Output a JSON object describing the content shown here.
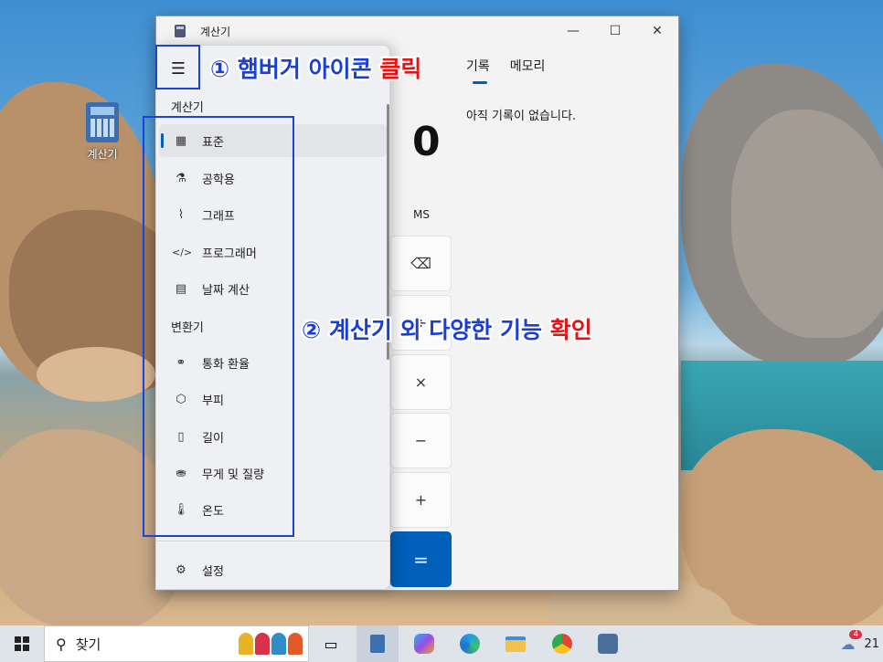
{
  "desktop": {
    "icon_label": "계산기"
  },
  "window": {
    "title": "계산기",
    "minimize_glyph": "—",
    "maximize_glyph": "☐",
    "close_glyph": "✕"
  },
  "history": {
    "tabs": [
      "기록",
      "메모리"
    ],
    "empty_text": "아직 기록이 없습니다."
  },
  "calculator": {
    "display": "0",
    "memory_store_label": "MS",
    "keys": [
      "⌫",
      "÷",
      "×",
      "−",
      "+",
      "="
    ]
  },
  "nav": {
    "calculator_section": "계산기",
    "calculator_items": [
      {
        "label": "표준",
        "icon": "calculator-icon",
        "glyph": "▦"
      },
      {
        "label": "공학용",
        "icon": "flask-icon",
        "glyph": "⚗"
      },
      {
        "label": "그래프",
        "icon": "graph-icon",
        "glyph": "⌇"
      },
      {
        "label": "프로그래머",
        "icon": "code-icon",
        "glyph": "</>"
      },
      {
        "label": "날짜 계산",
        "icon": "calendar-icon",
        "glyph": "▤"
      }
    ],
    "converter_section": "변환기",
    "converter_items": [
      {
        "label": "통화 환율",
        "icon": "currency-icon",
        "glyph": "⚭"
      },
      {
        "label": "부피",
        "icon": "cube-icon",
        "glyph": "⬡"
      },
      {
        "label": "길이",
        "icon": "ruler-icon",
        "glyph": "▯"
      },
      {
        "label": "무게 및 질량",
        "icon": "weight-icon",
        "glyph": "⛂"
      },
      {
        "label": "온도",
        "icon": "thermometer-icon",
        "glyph": "🌡"
      }
    ],
    "settings_label": "설정",
    "settings_glyph": "⚙",
    "selected": "표준"
  },
  "annotations": {
    "step1_num": "①",
    "step1_text": "햄버거 아이콘",
    "step1_red": "클릭",
    "step2_num": "②",
    "step2_text": "계산기 외 다양한 기능",
    "step2_red": "확인"
  },
  "taskbar": {
    "search_label": "찾기",
    "tray_badge": "4",
    "clock_partial": "21"
  },
  "colors": {
    "accent": "#005fb8",
    "annotation_blue": "#1a3fd8",
    "annotation_red": "#e01616"
  }
}
